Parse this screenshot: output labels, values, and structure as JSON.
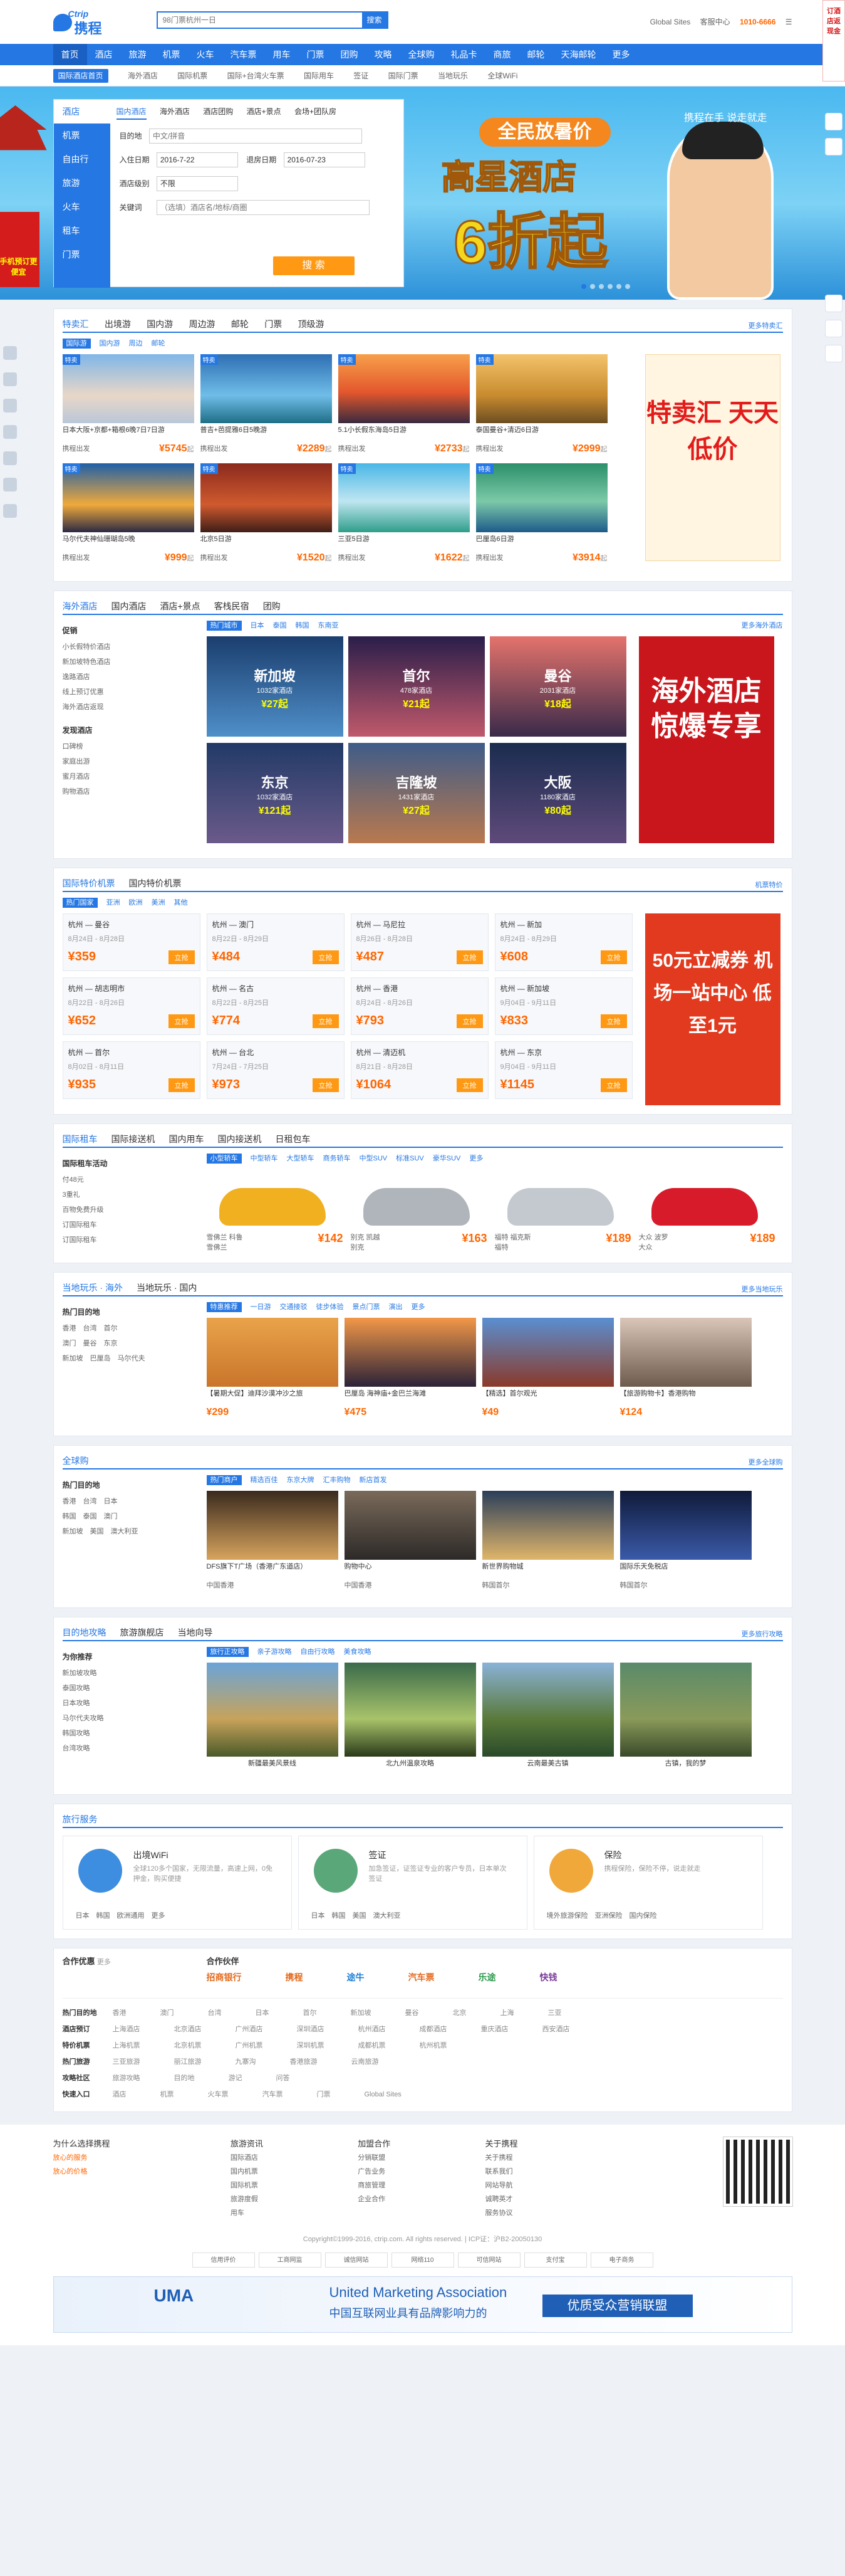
{
  "header": {
    "logo_en": "Ctrip",
    "logo_cn": "携程",
    "search_placeholder": "98门票杭州一日",
    "search_btn": "搜索",
    "links": [
      "Global Sites",
      "客服中心",
      "1010-6666",
      "☰"
    ]
  },
  "nav": {
    "items": [
      "首页",
      "酒店",
      "旅游",
      "机票",
      "火车",
      "汽车票",
      "用车",
      "门票",
      "团购",
      "攻略",
      "全球购",
      "礼品卡",
      "商旅",
      "邮轮",
      "天海邮轮",
      "更多"
    ],
    "hot_badge": "HOT"
  },
  "subnav": {
    "items": [
      "国际酒店首页",
      "海外酒店",
      "国际机票",
      "国际+台湾火车票",
      "国际用车",
      "签证",
      "国际门票",
      "当地玩乐",
      "全球WiFi"
    ]
  },
  "booking": {
    "vtabs": [
      "酒店",
      "机票",
      "自由行",
      "旅游",
      "火车",
      "租车",
      "门票"
    ],
    "htabs": [
      "国内酒店",
      "海外酒店",
      "酒店团购",
      "酒店+景点",
      "会场+团队房"
    ],
    "dest_label": "目的地",
    "dest_ph": "中文/拼音",
    "checkin_label": "入住日期",
    "checkin": "2016-7-22",
    "checkout_label": "退房日期",
    "checkout": "2016-07-23",
    "level_label": "酒店级别",
    "level": "不限",
    "kw_label": "关键词",
    "kw_ph": "（选填）酒店名/地标/商圈",
    "btn": "搜 索"
  },
  "banner": {
    "line1": "全民放暑价",
    "line2": "高星酒店",
    "line3": "6折起",
    "slogan": "携程在手 说走就走",
    "side_tag": "手机预订更便宜"
  },
  "rightrail": {
    "top": "订酒店返现金"
  },
  "sec_deals": {
    "tabs": [
      "特卖汇",
      "出境游",
      "国内游",
      "周边游",
      "邮轮",
      "门票",
      "顶级游"
    ],
    "chips": [
      "国际游",
      "国内游",
      "周边",
      "邮轮"
    ],
    "more": "更多特卖汇",
    "cards": [
      {
        "tag": "特卖",
        "title": "日本大阪+京都+箱根6晚7日7日游",
        "from": "携程出发",
        "price": "¥5745",
        "unit": "起"
      },
      {
        "tag": "特卖",
        "title": "普吉+芭提雅6日5晚游",
        "from": "携程出发",
        "price": "¥2289",
        "unit": "起"
      },
      {
        "tag": "特卖",
        "title": "5.1小长假东海岛5日游",
        "from": "携程出发",
        "price": "¥2733",
        "unit": "起"
      },
      {
        "tag": "特卖",
        "title": "泰国曼谷+清迈6日游",
        "from": "携程出发",
        "price": "¥2999",
        "unit": "起"
      },
      {
        "tag": "特卖",
        "title": "马尔代夫神仙珊瑚岛5晚",
        "from": "携程出发",
        "price": "¥999",
        "unit": "起"
      },
      {
        "tag": "特卖",
        "title": "北京5日游",
        "from": "携程出发",
        "price": "¥1520",
        "unit": "起"
      },
      {
        "tag": "特卖",
        "title": "三亚5日游",
        "from": "携程出发",
        "price": "¥1622",
        "unit": "起"
      },
      {
        "tag": "特卖",
        "title": "巴厘岛6日游",
        "from": "携程出发",
        "price": "¥3914",
        "unit": "起"
      }
    ],
    "promo": "特卖汇 天天低价"
  },
  "sec_hotels": {
    "tabs": [
      "海外酒店",
      "国内酒店",
      "酒店+景点",
      "客栈民宿",
      "团购"
    ],
    "more": "更多海外酒店",
    "left_h1": "促销",
    "left_items": [
      "小长假特价酒店",
      "新加坡特色酒店",
      "逸路酒店",
      "线上预订优惠",
      "海外酒店返现"
    ],
    "left_h2": "发现酒店",
    "left_items2": [
      "口碑榜",
      "家庭出游",
      "蜜月酒店",
      "购物酒店"
    ],
    "chips": [
      "热门城市",
      "日本",
      "泰国",
      "韩国",
      "东南亚"
    ],
    "tiles": [
      {
        "city": "新加坡",
        "info": "1032家酒店",
        "price": "¥27起"
      },
      {
        "city": "首尔",
        "info": "478家酒店",
        "price": "¥21起"
      },
      {
        "city": "曼谷",
        "info": "2031家酒店",
        "price": "¥18起"
      },
      {
        "city": "东京",
        "info": "1032家酒店",
        "price": "¥121起"
      },
      {
        "city": "吉隆坡",
        "info": "1431家酒店",
        "price": "¥27起"
      },
      {
        "city": "大阪",
        "info": "1180家酒店",
        "price": "¥80起"
      }
    ],
    "promo": "海外酒店 惊爆专享"
  },
  "sec_flights": {
    "tabs": [
      "国际特价机票",
      "国内特价机票"
    ],
    "more": "机票特价",
    "chips": [
      "热门国家",
      "亚洲",
      "欧洲",
      "美洲",
      "其他"
    ],
    "items": [
      {
        "r": "杭州 — 曼谷",
        "d": "8月24日 - 8月28日",
        "p": "¥359",
        "u": "起"
      },
      {
        "r": "杭州 — 澳门",
        "d": "8月22日 - 8月29日",
        "p": "¥484",
        "u": "起"
      },
      {
        "r": "杭州 — 马尼拉",
        "d": "8月26日 - 8月28日",
        "p": "¥487",
        "u": "起"
      },
      {
        "r": "杭州 — 新加",
        "d": "8月24日 - 8月29日",
        "p": "¥608",
        "u": "起"
      },
      {
        "r": "杭州 — 胡志明市",
        "d": "8月22日 - 8月26日",
        "p": "¥652",
        "u": "起"
      },
      {
        "r": "杭州 — 名古",
        "d": "8月22日 - 8月25日",
        "p": "¥774",
        "u": "起"
      },
      {
        "r": "杭州 — 香港",
        "d": "8月24日 - 8月26日",
        "p": "¥793",
        "u": "起"
      },
      {
        "r": "杭州 — 新加坡",
        "d": "9月04日 - 9月11日",
        "p": "¥833",
        "u": "起"
      },
      {
        "r": "杭州 — 首尔",
        "d": "8月02日 - 8月11日",
        "p": "¥935",
        "u": "起"
      },
      {
        "r": "杭州 — 台北",
        "d": "7月24日 - 7月25日",
        "p": "¥973",
        "u": "起"
      },
      {
        "r": "杭州 — 清迈机",
        "d": "8月21日 - 8月28日",
        "p": "¥1064",
        "u": "起"
      },
      {
        "r": "杭州 — 东京",
        "d": "9月04日 - 9月11日",
        "p": "¥1145",
        "u": "起"
      }
    ],
    "btn": "立抢",
    "promo": "50元立减券 机场一站中心 低至1元"
  },
  "sec_car": {
    "tabs": [
      "国际租车",
      "国际接送机",
      "国内用车",
      "国内接送机",
      "日租包车"
    ],
    "left_h": "国际租车活动",
    "left_items": [
      "付48元",
      "3重礼",
      "百物免费升级",
      "订国际租车",
      "订国际租车"
    ],
    "chips": [
      "小型轿车",
      "中型轿车",
      "大型轿车",
      "商务轿车",
      "中型SUV",
      "标准SUV",
      "豪华SUV",
      "更多"
    ],
    "cars": [
      {
        "name": "雪佛兰 科鲁",
        "place": "雪佛兰",
        "price": "¥142",
        "u": "起"
      },
      {
        "name": "别克 凯越",
        "place": "别克",
        "price": "¥163",
        "u": "起"
      },
      {
        "name": "福特 福克斯",
        "place": "福特",
        "price": "¥189",
        "u": "起"
      },
      {
        "name": "大众 波罗",
        "place": "大众",
        "price": "¥189",
        "u": "起"
      }
    ]
  },
  "sec_fun": {
    "tabs": [
      "当地玩乐 · 海外",
      "当地玩乐 · 国内"
    ],
    "more": "更多当地玩乐",
    "left_h": "热门目的地",
    "left_items": [
      "香港",
      "台湾",
      "首尔",
      "澳门",
      "曼谷",
      "东京",
      "新加坡",
      "巴厘岛",
      "马尔代夫"
    ],
    "chips": [
      "特惠推荐",
      "一日游",
      "交通接驳",
      "徒步体验",
      "景点门票",
      "演出",
      "更多"
    ],
    "cards": [
      {
        "t": "【暑期大促】迪拜沙漠冲沙之旅",
        "p": "¥299",
        "u": "起"
      },
      {
        "t": "巴厘岛 海神庙+金巴兰海滩",
        "p": "¥475",
        "u": "起"
      },
      {
        "t": "【精选】首尔观光",
        "p": "¥49",
        "u": "起"
      },
      {
        "t": "【旅游购物卡】香港购物",
        "p": "¥124",
        "u": "起"
      }
    ]
  },
  "sec_shop": {
    "tabs": [
      "全球购"
    ],
    "more": "更多全球购",
    "left_h": "热门目的地",
    "left_items": [
      "香港",
      "台湾",
      "日本",
      "韩国",
      "泰国",
      "澳门",
      "新加坡",
      "美国",
      "澳大利亚",
      "英国"
    ],
    "chips": [
      "热门商户",
      "精选百佳",
      "东京大牌",
      "汇丰购物",
      "新店首发"
    ],
    "cards": [
      {
        "t": "DFS旗下T广场（香港广东道店）",
        "loc": "中国香港"
      },
      {
        "t": "购物中心",
        "loc": "中国香港"
      },
      {
        "t": "新世界购物城",
        "loc": "韩国首尔"
      },
      {
        "t": "国际乐天免税店",
        "loc": "韩国首尔"
      }
    ]
  },
  "sec_guide": {
    "tabs": [
      "目的地攻略",
      "旅游旗舰店",
      "当地向导"
    ],
    "more": "更多旅行攻略",
    "left_h": "为你推荐",
    "left_items": [
      "新加坡攻略",
      "泰国攻略",
      "日本攻略",
      "马尔代夫攻略",
      "韩国攻略",
      "台湾攻略"
    ],
    "chips": [
      "旅行正攻略",
      "亲子游攻略",
      "自由行攻略",
      "美食攻略"
    ],
    "cards": [
      {
        "t": "新疆最美风景线"
      },
      {
        "t": "北九州温泉攻略"
      },
      {
        "t": "云南最美古镇"
      },
      {
        "t": "古镇，我的梦"
      }
    ]
  },
  "sec_services": {
    "title": "旅行服务",
    "items": [
      {
        "h": "出境WiFi",
        "p": "全球120多个国家，无限流量，高速上网，0免押金，购买便捷",
        "b": [
          "日本",
          "韩国",
          "欧洲通用",
          "更多"
        ]
      },
      {
        "h": "签证",
        "p": "加急签证，证签证专业的客户专员，日本单次签证",
        "b": [
          "日本",
          "韩国",
          "美国",
          "澳大利亚"
        ]
      },
      {
        "h": "保险",
        "p": "携程保险，保险不停，说走就走",
        "b": [
          "境外旅游保险",
          "亚洲保险",
          "国内保险"
        ]
      }
    ]
  },
  "partners": {
    "h1": "合作优惠",
    "h2": "合作伙伴",
    "more": "更多",
    "logos": [
      "招商银行",
      "携程",
      "途牛",
      "汽车票",
      "乐途",
      "快钱"
    ]
  },
  "links": {
    "rows": [
      {
        "h": "热门目的地",
        "items": [
          "香港",
          "澳门",
          "台湾",
          "日本",
          "首尔",
          "新加坡",
          "曼谷",
          "北京",
          "上海",
          "三亚"
        ]
      },
      {
        "h": "酒店预订",
        "items": [
          "上海酒店",
          "北京酒店",
          "广州酒店",
          "深圳酒店",
          "杭州酒店",
          "成都酒店",
          "重庆酒店",
          "西安酒店"
        ]
      },
      {
        "h": "特价机票",
        "items": [
          "上海机票",
          "北京机票",
          "广州机票",
          "深圳机票",
          "成都机票",
          "杭州机票"
        ]
      },
      {
        "h": "热门旅游",
        "items": [
          "三亚旅游",
          "丽江旅游",
          "九寨沟",
          "香港旅游",
          "云南旅游"
        ]
      },
      {
        "h": "攻略社区",
        "items": [
          "旅游攻略",
          "目的地",
          "游记",
          "问答"
        ]
      },
      {
        "h": "快速入口",
        "items": [
          "酒店",
          "机票",
          "火车票",
          "汽车票",
          "门票",
          "Global Sites"
        ]
      }
    ]
  },
  "footer": {
    "cols": [
      {
        "h": "为什么选择携程",
        "items": [
          "放心的服务",
          "放心的价格"
        ]
      },
      {
        "h": "旅游资讯",
        "items": [
          "国际酒店",
          "国内机票",
          "国际机票",
          "旅游度假",
          "用车"
        ]
      },
      {
        "h": "加盟合作",
        "items": [
          "分销联盟",
          "广告业务",
          "商旅管理",
          "企业合作"
        ]
      },
      {
        "h": "关于携程",
        "items": [
          "关于携程",
          "联系我们",
          "网站导航",
          "诚聘英才",
          "服务协议"
        ]
      }
    ],
    "copy": "Copyright©1999-2016, ctrip.com. All rights reserved. | ICP证：沪B2-20050130",
    "badges": [
      "信用评价",
      "工商网监",
      "诚信网站",
      "网络110",
      "可信网站",
      "支付宝",
      "电子商务"
    ]
  },
  "uma": {
    "u1": "UMA",
    "u2": "United Marketing Association",
    "u3": "中国互联网业具有品牌影响力的",
    "u4": "优质受众营销联盟"
  }
}
